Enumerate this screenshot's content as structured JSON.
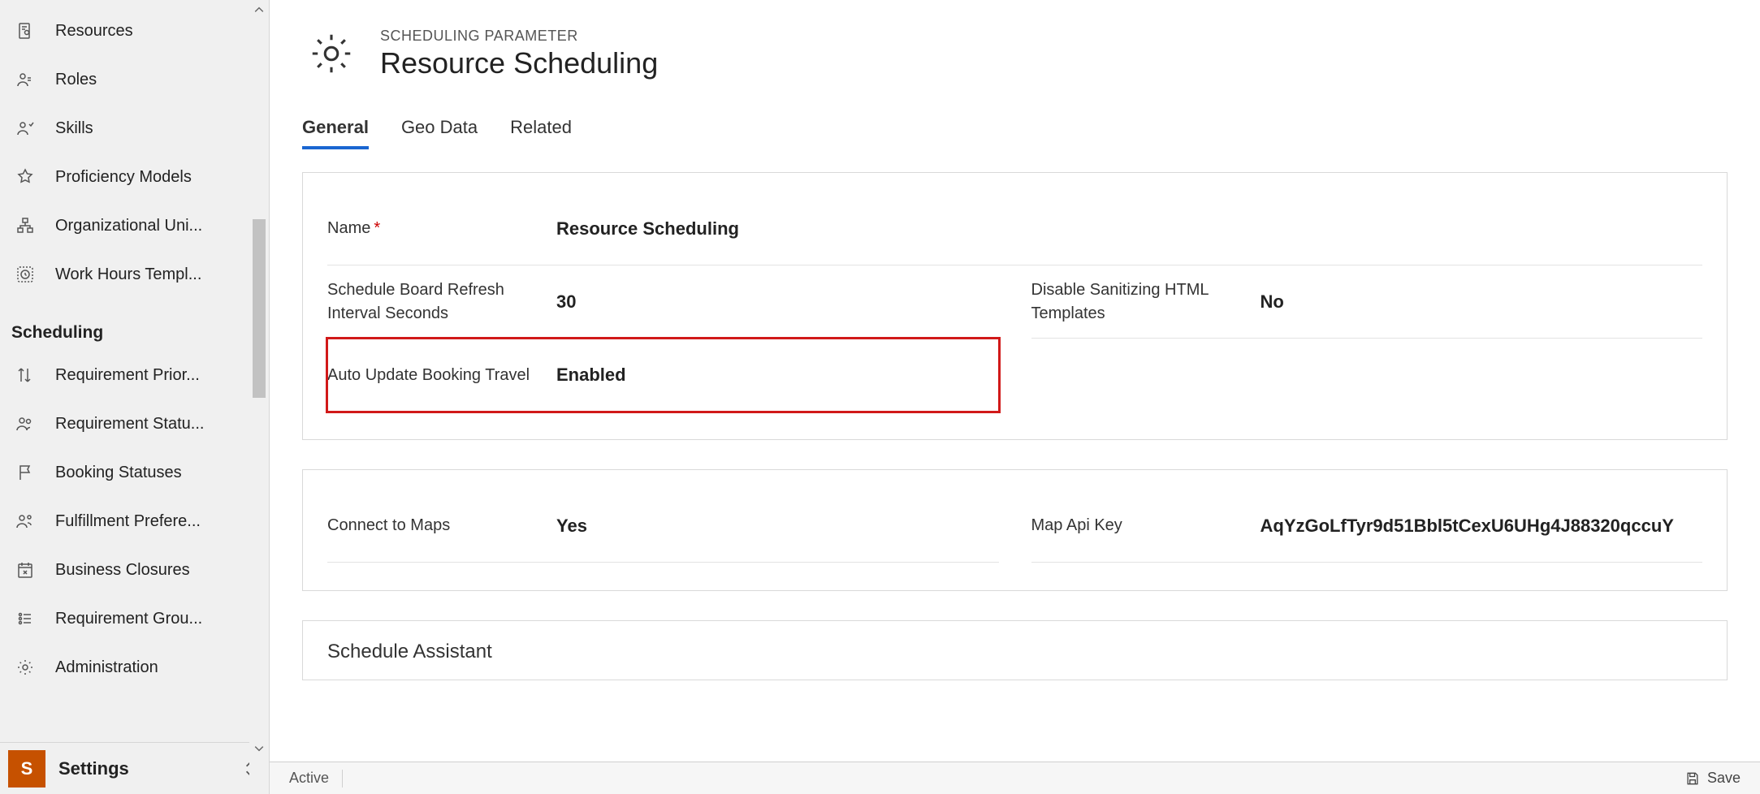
{
  "sidebar": {
    "items_top": [
      {
        "label": "Resources"
      },
      {
        "label": "Roles"
      },
      {
        "label": "Skills"
      },
      {
        "label": "Proficiency Models"
      },
      {
        "label": "Organizational Uni..."
      },
      {
        "label": "Work Hours Templ..."
      }
    ],
    "section_label": "Scheduling",
    "items_sched": [
      {
        "label": "Requirement Prior..."
      },
      {
        "label": "Requirement Statu..."
      },
      {
        "label": "Booking Statuses"
      },
      {
        "label": "Fulfillment Prefere..."
      },
      {
        "label": "Business Closures"
      },
      {
        "label": "Requirement Grou..."
      },
      {
        "label": "Administration"
      }
    ]
  },
  "area": {
    "badge": "S",
    "name": "Settings"
  },
  "header": {
    "entity_kind": "SCHEDULING PARAMETER",
    "title": "Resource Scheduling"
  },
  "tabs": {
    "general": "General",
    "geo": "Geo Data",
    "related": "Related"
  },
  "form": {
    "name_label": "Name",
    "name_value": "Resource Scheduling",
    "refresh_label": "Schedule Board Refresh Interval Seconds",
    "refresh_value": "30",
    "sanitize_label": "Disable Sanitizing HTML Templates",
    "sanitize_value": "No",
    "auto_travel_label": "Auto Update Booking Travel",
    "auto_travel_value": "Enabled",
    "connect_maps_label": "Connect to Maps",
    "connect_maps_value": "Yes",
    "map_key_label": "Map Api Key",
    "map_key_value": "AqYzGoLfTyr9d51Bbl5tCexU6UHg4J88320qccuY",
    "schedule_assistant_title": "Schedule Assistant"
  },
  "statusbar": {
    "state": "Active",
    "save": "Save"
  }
}
